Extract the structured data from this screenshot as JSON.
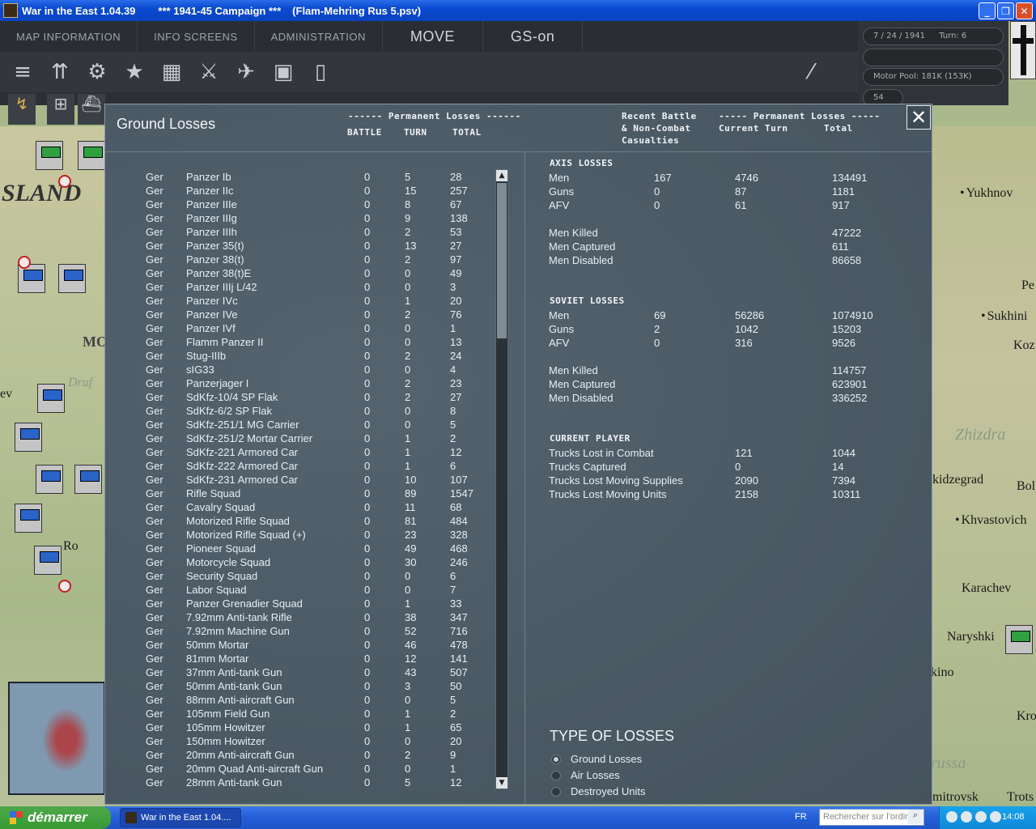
{
  "window": {
    "app_title": "War in the East 1.04.39",
    "campaign": "***   1941-45 Campaign   ***",
    "save_file": "(Flam-Mehring Rus 5.psv)",
    "minimize": "_",
    "maximize": "❐",
    "close": "✕"
  },
  "topbar": {
    "tabs": [
      "MAP INFORMATION",
      "INFO SCREENS",
      "ADMINISTRATION",
      "MOVE",
      "GS-on"
    ]
  },
  "status": {
    "date": "7 / 24 / 1941",
    "turn": "Turn: 6",
    "motor_pool": "Motor Pool:  181K (153K)",
    "field_value": "54"
  },
  "map": {
    "labels": [
      "SLAND",
      "Yukhnov",
      "MO",
      "Sukhini",
      "Koz",
      "Druf",
      "ev",
      "Zhizdra",
      "kidzegrad",
      "Bol",
      "Khvastovich",
      "Ro",
      "Karachev",
      "Naryshki",
      "kino",
      "Kro",
      "russa",
      "mitrovsk",
      "Trots",
      "Pe"
    ]
  },
  "dialog": {
    "title": "Ground Losses",
    "close_icon": "✕",
    "left_header": {
      "group": "------ Permanent Losses ------",
      "battle": "BATTLE",
      "turn": "TURN",
      "total": "TOTAL"
    },
    "right_header": {
      "recent": [
        "Recent Battle",
        "& Non-Combat",
        "Casualties"
      ],
      "group": "----- Permanent Losses -----",
      "current": "Current Turn",
      "total": "Total"
    },
    "rows": [
      [
        "Ger",
        "Panzer Ib",
        "0",
        "5",
        "28"
      ],
      [
        "Ger",
        "Panzer IIc",
        "0",
        "15",
        "257"
      ],
      [
        "Ger",
        "Panzer IIIe",
        "0",
        "8",
        "67"
      ],
      [
        "Ger",
        "Panzer IIIg",
        "0",
        "9",
        "138"
      ],
      [
        "Ger",
        "Panzer IIIh",
        "0",
        "2",
        "53"
      ],
      [
        "Ger",
        "Panzer 35(t)",
        "0",
        "13",
        "27"
      ],
      [
        "Ger",
        "Panzer 38(t)",
        "0",
        "2",
        "97"
      ],
      [
        "Ger",
        "Panzer 38(t)E",
        "0",
        "0",
        "49"
      ],
      [
        "Ger",
        "Panzer IIIj L/42",
        "0",
        "0",
        "3"
      ],
      [
        "Ger",
        "Panzer IVc",
        "0",
        "1",
        "20"
      ],
      [
        "Ger",
        "Panzer IVe",
        "0",
        "2",
        "76"
      ],
      [
        "Ger",
        "Panzer IVf",
        "0",
        "0",
        "1"
      ],
      [
        "Ger",
        "Flamm Panzer II",
        "0",
        "0",
        "13"
      ],
      [
        "Ger",
        "Stug-IIIb",
        "0",
        "2",
        "24"
      ],
      [
        "Ger",
        "sIG33",
        "0",
        "0",
        "4"
      ],
      [
        "Ger",
        "Panzerjager I",
        "0",
        "2",
        "23"
      ],
      [
        "Ger",
        "SdKfz-10/4 SP Flak",
        "0",
        "2",
        "27"
      ],
      [
        "Ger",
        "SdKfz-6/2 SP Flak",
        "0",
        "0",
        "8"
      ],
      [
        "Ger",
        "SdKfz-251/1 MG Carrier",
        "0",
        "0",
        "5"
      ],
      [
        "Ger",
        "SdKfz-251/2 Mortar Carrier",
        "0",
        "1",
        "2"
      ],
      [
        "Ger",
        "SdKfz-221 Armored Car",
        "0",
        "1",
        "12"
      ],
      [
        "Ger",
        "SdKfz-222 Armored Car",
        "0",
        "1",
        "6"
      ],
      [
        "Ger",
        "SdKfz-231 Armored Car",
        "0",
        "10",
        "107"
      ],
      [
        "Ger",
        "Rifle Squad",
        "0",
        "89",
        "1547"
      ],
      [
        "Ger",
        "Cavalry Squad",
        "0",
        "11",
        "68"
      ],
      [
        "Ger",
        "Motorized Rifle Squad",
        "0",
        "81",
        "484"
      ],
      [
        "Ger",
        "Motorized Rifle Squad (+)",
        "0",
        "23",
        "328"
      ],
      [
        "Ger",
        "Pioneer Squad",
        "0",
        "49",
        "468"
      ],
      [
        "Ger",
        "Motorcycle Squad",
        "0",
        "30",
        "246"
      ],
      [
        "Ger",
        "Security Squad",
        "0",
        "0",
        "6"
      ],
      [
        "Ger",
        "Labor Squad",
        "0",
        "0",
        "7"
      ],
      [
        "Ger",
        "Panzer Grenadier Squad",
        "0",
        "1",
        "33"
      ],
      [
        "Ger",
        "7.92mm Anti-tank Rifle",
        "0",
        "38",
        "347"
      ],
      [
        "Ger",
        "7.92mm Machine Gun",
        "0",
        "52",
        "716"
      ],
      [
        "Ger",
        "50mm Mortar",
        "0",
        "46",
        "478"
      ],
      [
        "Ger",
        "81mm Mortar",
        "0",
        "12",
        "141"
      ],
      [
        "Ger",
        "37mm Anti-tank Gun",
        "0",
        "43",
        "507"
      ],
      [
        "Ger",
        "50mm Anti-tank Gun",
        "0",
        "3",
        "50"
      ],
      [
        "Ger",
        "88mm Anti-aircraft Gun",
        "0",
        "0",
        "5"
      ],
      [
        "Ger",
        "105mm Field Gun",
        "0",
        "1",
        "2"
      ],
      [
        "Ger",
        "105mm Howitzer",
        "0",
        "1",
        "65"
      ],
      [
        "Ger",
        "150mm Howitzer",
        "0",
        "0",
        "20"
      ],
      [
        "Ger",
        "20mm Anti-aircraft Gun",
        "0",
        "2",
        "9"
      ],
      [
        "Ger",
        "20mm Quad Anti-aircraft Gun",
        "0",
        "0",
        "1"
      ],
      [
        "Ger",
        "28mm Anti-tank Gun",
        "0",
        "5",
        "12"
      ]
    ],
    "scroll_up": "▲",
    "scroll_down": "▼",
    "axis": {
      "title": "AXIS LOSSES",
      "rows": [
        [
          "Men",
          "167",
          "4746",
          "134491"
        ],
        [
          "Guns",
          "0",
          "87",
          "1181"
        ],
        [
          "AFV",
          "0",
          "61",
          "917"
        ]
      ],
      "detail": [
        [
          "Men Killed",
          "47222"
        ],
        [
          "Men Captured",
          "611"
        ],
        [
          "Men Disabled",
          "86658"
        ]
      ]
    },
    "soviet": {
      "title": "SOVIET LOSSES",
      "rows": [
        [
          "Men",
          "69",
          "56286",
          "1074910"
        ],
        [
          "Guns",
          "2",
          "1042",
          "15203"
        ],
        [
          "AFV",
          "0",
          "316",
          "9526"
        ]
      ],
      "detail": [
        [
          "Men Killed",
          "114757"
        ],
        [
          "Men Captured",
          "623901"
        ],
        [
          "Men Disabled",
          "336252"
        ]
      ]
    },
    "current_player": {
      "title": "CURRENT PLAYER",
      "rows": [
        [
          "Trucks Lost in Combat",
          "121",
          "1044"
        ],
        [
          "Trucks Captured",
          "0",
          "14"
        ],
        [
          "Trucks Lost Moving Supplies",
          "2090",
          "7394"
        ],
        [
          "Trucks Lost Moving Units",
          "2158",
          "10311"
        ]
      ]
    },
    "types": {
      "title": "TYPE OF LOSSES",
      "options": [
        "Ground Losses",
        "Air Losses",
        "Destroyed Units"
      ],
      "selected": "Ground Losses"
    }
  },
  "taskbar": {
    "start": "démarrer",
    "task": "War in the East 1.04....",
    "lang": "FR",
    "search_placeholder": "Rechercher sur l'ordin",
    "clock": "14:08"
  }
}
